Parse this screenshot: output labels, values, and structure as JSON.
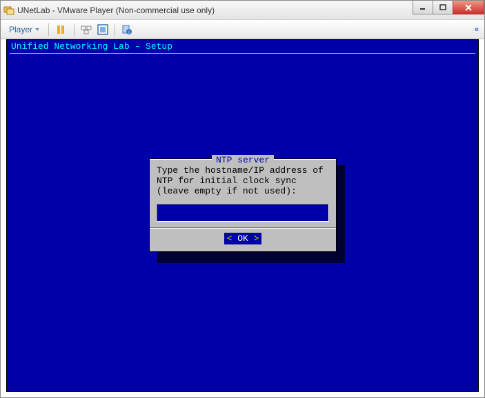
{
  "window": {
    "title": "UNetLab - VMware Player (Non-commercial use only)"
  },
  "toolbar": {
    "player_label": "Player"
  },
  "terminal": {
    "header": "Unified Networking Lab - Setup"
  },
  "dialog": {
    "title": "NTP server",
    "message": "Type the hostname/IP address of NTP for initial clock sync (leave empty if not used):",
    "input_value": "",
    "ok_label": "OK"
  }
}
